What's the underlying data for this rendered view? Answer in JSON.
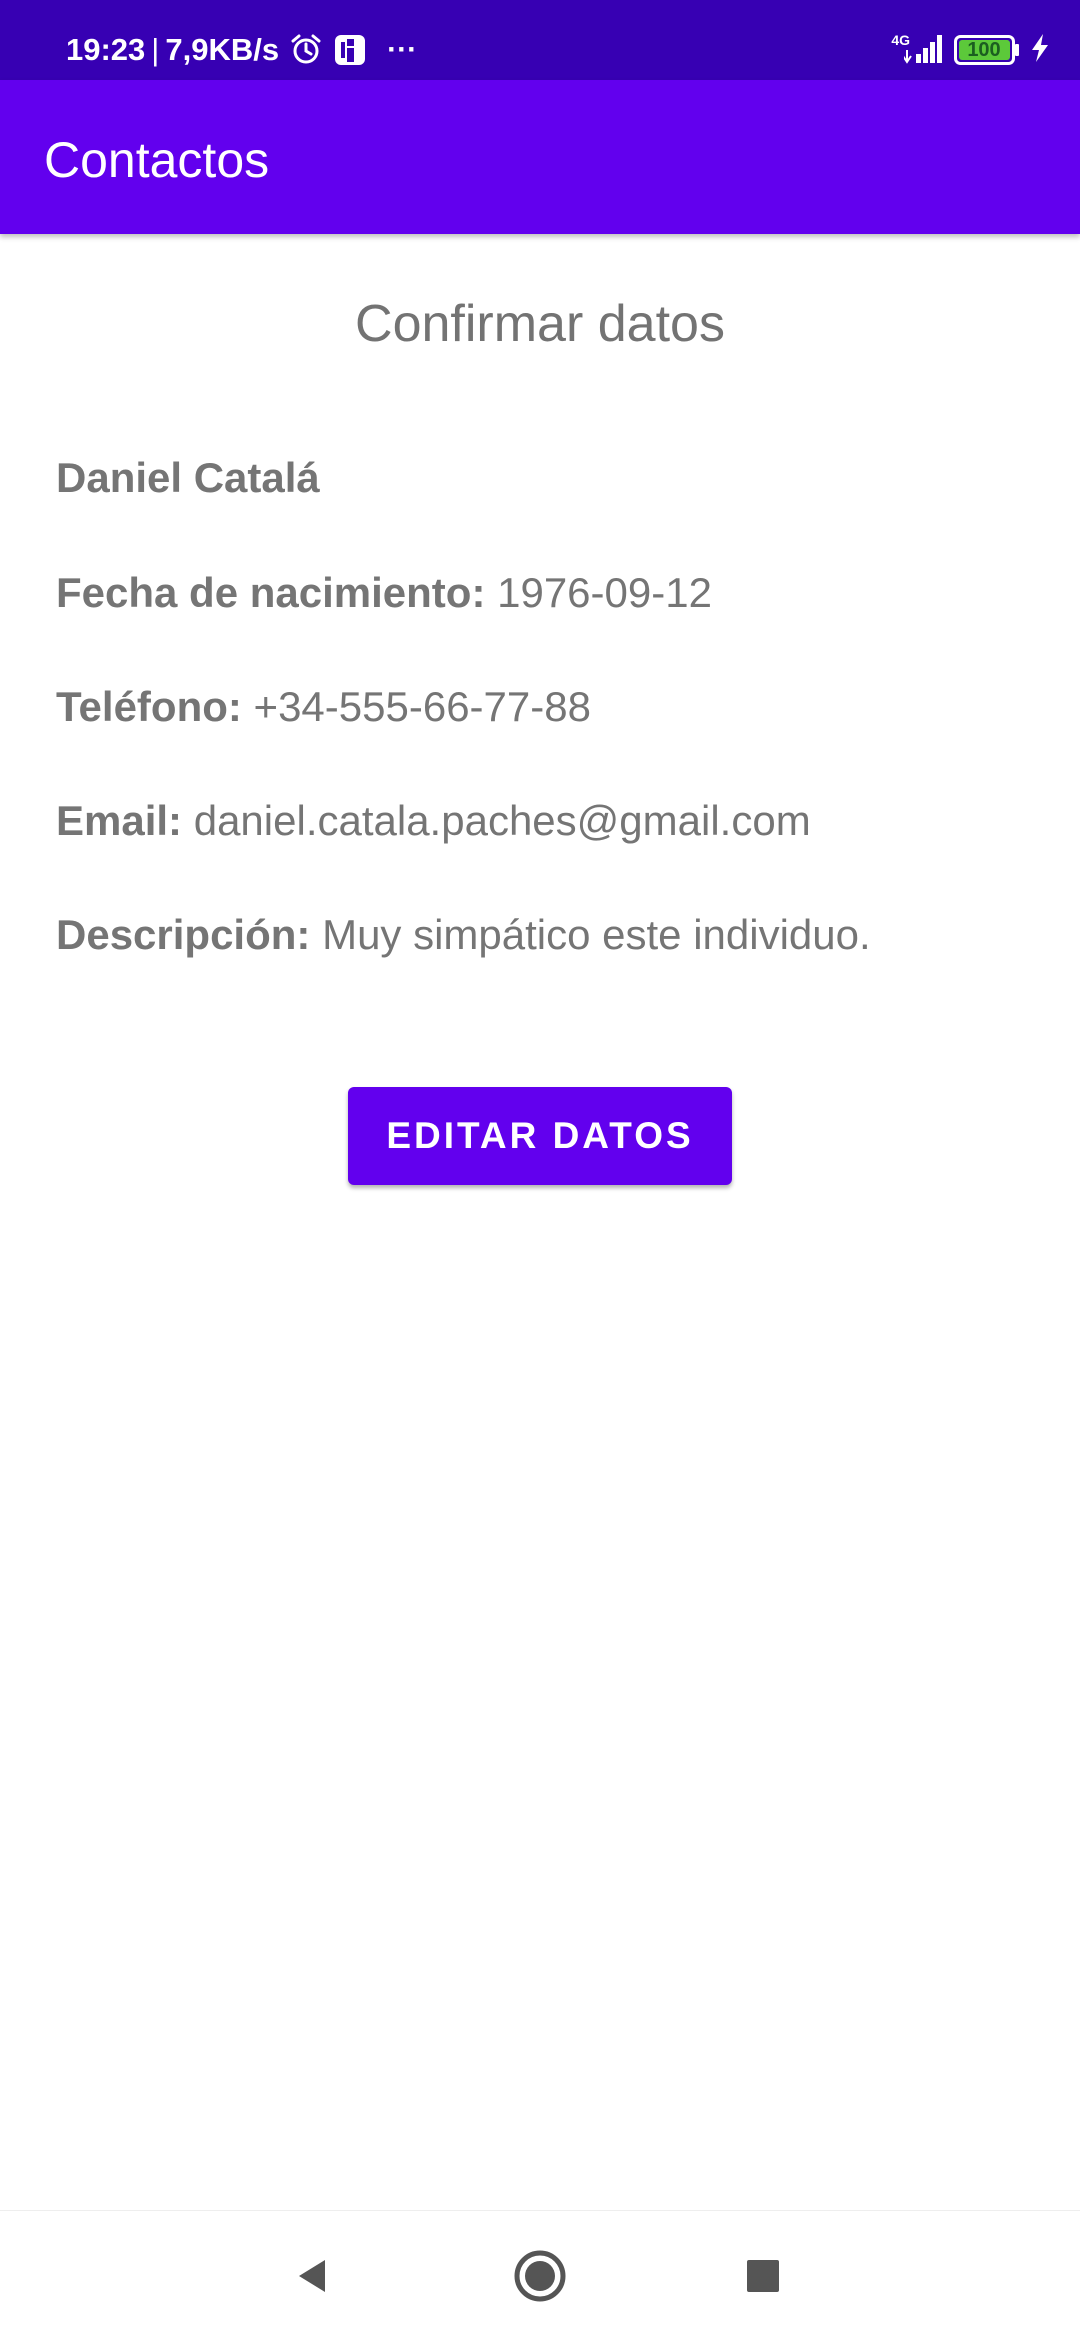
{
  "status_bar": {
    "time": "19:23",
    "net_speed": "7,9KB/s",
    "more": "···",
    "network_type": "4G",
    "battery": "100",
    "icons": [
      "alarm-icon",
      "notification-app-icon",
      "signal-icon",
      "battery-icon",
      "charging-icon"
    ]
  },
  "app_bar": {
    "title": "Contactos"
  },
  "content": {
    "heading": "Confirmar datos",
    "name": "Daniel Catalá",
    "birth_label": "Fecha de nacimiento:",
    "birth_value": "1976-09-12",
    "phone_label": "Teléfono:",
    "phone_value": "+34-555-66-77-88",
    "email_label": "Email:",
    "email_value": "daniel.catala.paches@gmail.com",
    "description_label": "Descripción:",
    "description_value": "Muy simpático este individuo.",
    "edit_button": "EDITAR DATOS"
  },
  "nav_bar": {
    "icons": [
      "back-icon",
      "home-icon",
      "recents-icon"
    ]
  },
  "colors": {
    "status_bar": "#3700B3",
    "primary": "#6200EE",
    "text_secondary": "#757575",
    "battery_fill": "#5CC93A"
  }
}
